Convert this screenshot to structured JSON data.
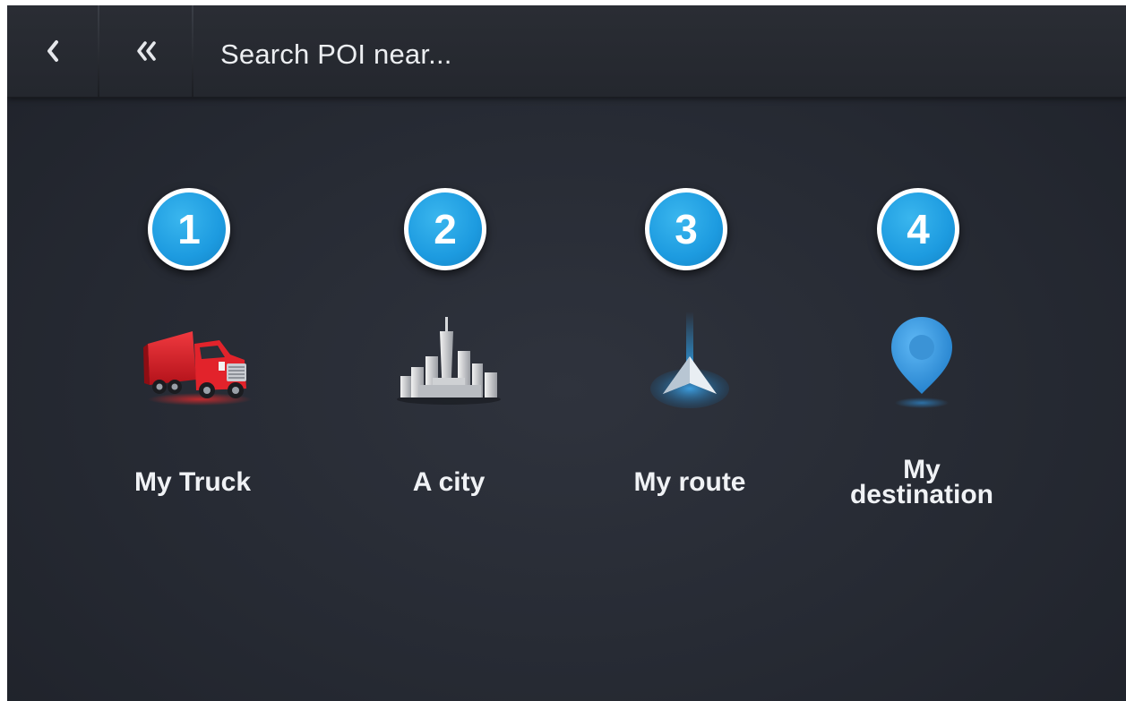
{
  "header": {
    "title": "Search POI near...",
    "back_icon": "chevron-left-icon",
    "home_icon": "double-chevron-left-icon"
  },
  "options": [
    {
      "number": "1",
      "label": "My Truck",
      "icon": "truck-icon"
    },
    {
      "number": "2",
      "label": "A city",
      "icon": "city-icon"
    },
    {
      "number": "3",
      "label": "My route",
      "icon": "route-arrow-icon"
    },
    {
      "number": "4",
      "label_line1": "My",
      "label_line2": "destination",
      "icon": "location-pin-icon"
    }
  ],
  "colors": {
    "background": "#262a33",
    "topbar": "#272a31",
    "badge": "#1d9be0",
    "truck": "#d8141b",
    "pin": "#3a9ee6"
  }
}
